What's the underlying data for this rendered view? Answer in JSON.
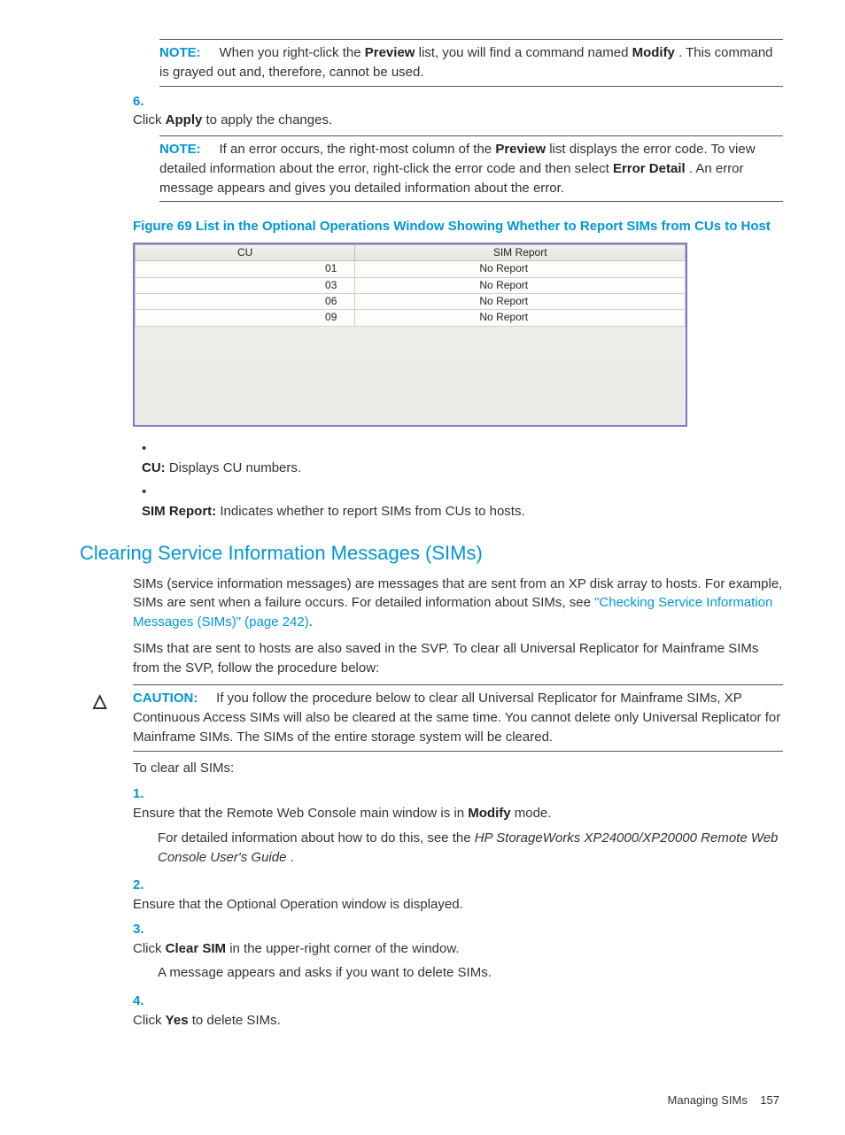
{
  "noteA": {
    "label": "NOTE:",
    "p1a": "When you right-click the ",
    "p1b": "Preview",
    "p1c": " list, you will find a command named ",
    "p1d": "Modify",
    "p1e": ". This command is grayed out and, therefore, cannot be used."
  },
  "step6": {
    "num": "6.",
    "a": "Click ",
    "b": "Apply",
    "c": " to apply the changes."
  },
  "noteB": {
    "label": "NOTE:",
    "a": "If an error occurs, the right-most column of the ",
    "b": "Preview",
    "c": " list displays the error code. To view detailed information about the error, right-click the error code and then select ",
    "d": "Error Detail",
    "e": ". An error message appears and gives you detailed information about the error."
  },
  "fig": {
    "caption": "Figure 69 List in the Optional Operations Window Showing Whether to Report SIMs from CUs to Host",
    "h1": "CU",
    "h2": "SIM Report",
    "rows": [
      {
        "cu": "01",
        "r": "No Report"
      },
      {
        "cu": "03",
        "r": "No Report"
      },
      {
        "cu": "06",
        "r": "No Report"
      },
      {
        "cu": "09",
        "r": "No Report"
      }
    ]
  },
  "bullets": {
    "b1a": "CU:",
    "b1b": " Displays CU numbers.",
    "b2a": "SIM Report:",
    "b2b": " Indicates whether to report SIMs from CUs to hosts."
  },
  "section": {
    "title": "Clearing Service Information Messages (SIMs)",
    "p1a": "SIMs (service information messages) are messages that are sent from an XP disk array to hosts. For example, SIMs are sent when a failure occurs. For detailed information about SIMs, see ",
    "p1link": "\"Checking Service Information Messages (SIMs)\" (page 242)",
    "p1b": ".",
    "p2": "SIMs that are sent to hosts are also saved in the SVP. To clear all Universal Replicator for Mainframe SIMs from the SVP, follow the procedure below:"
  },
  "caution": {
    "icon": "△",
    "label": "CAUTION:",
    "text": "If you follow the procedure below to clear all Universal Replicator for Mainframe SIMs, XP Continuous Access SIMs will also be cleared at the same time. You cannot delete only Universal Replicator for Mainframe SIMs. The SIMs of the entire storage system will be cleared."
  },
  "proc": {
    "lead": "To clear all SIMs:",
    "s1": {
      "n": "1.",
      "a": "Ensure that the Remote Web Console main window is in ",
      "b": "Modify",
      "c": " mode.",
      "sub_a": "For detailed information about how to do this, see the ",
      "sub_i": "HP StorageWorks XP24000/XP20000 Remote Web Console User's Guide",
      "sub_c": "."
    },
    "s2": {
      "n": "2.",
      "t": "Ensure that the Optional Operation window is displayed."
    },
    "s3": {
      "n": "3.",
      "a": "Click ",
      "b": "Clear SIM",
      "c": " in the upper-right corner of the window.",
      "sub": "A message appears and asks if you want to delete SIMs."
    },
    "s4": {
      "n": "4.",
      "a": "Click ",
      "b": "Yes",
      "c": " to delete SIMs."
    }
  },
  "footer": {
    "label": "Managing SIMs",
    "page": "157"
  }
}
